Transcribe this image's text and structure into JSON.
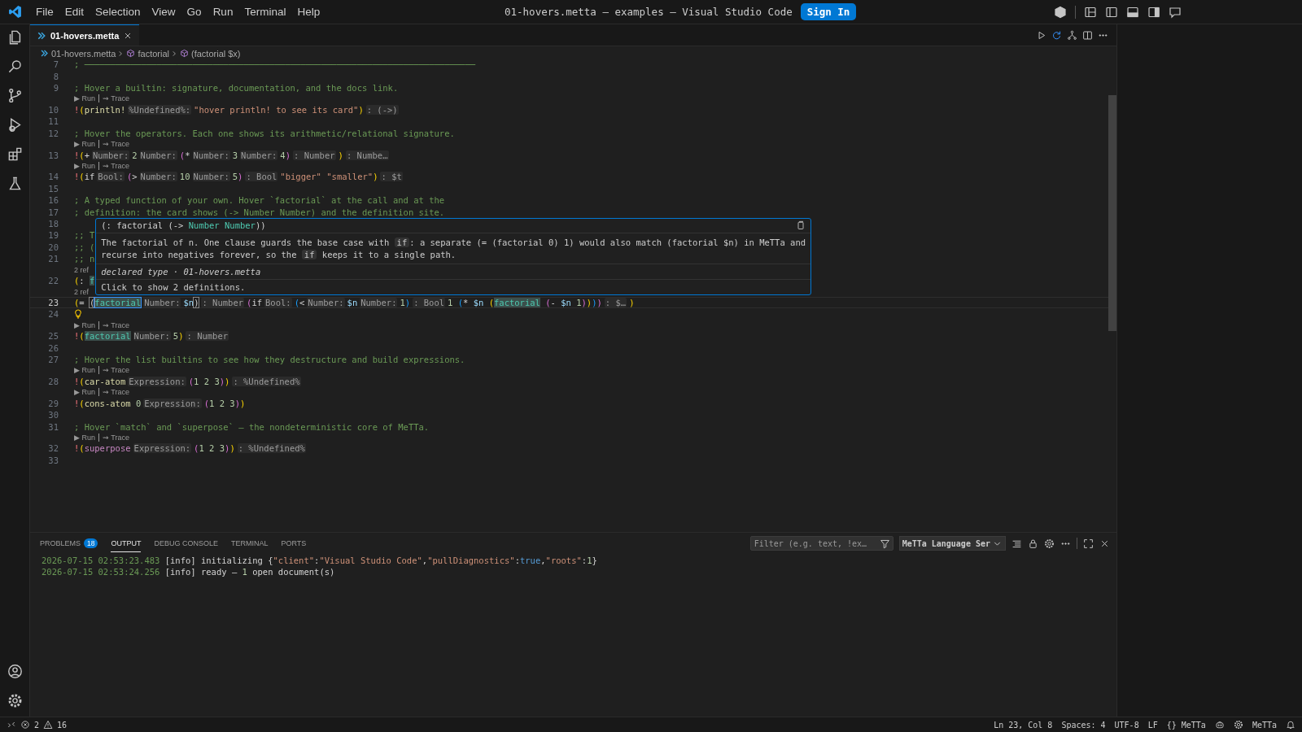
{
  "window": {
    "title": "01-hovers.metta — examples — Visual Studio Code",
    "sign_in": "Sign In"
  },
  "menu": [
    "File",
    "Edit",
    "Selection",
    "View",
    "Go",
    "Run",
    "Terminal",
    "Help"
  ],
  "editor_tabs": [
    {
      "label": "01-hovers.metta",
      "selected": true
    }
  ],
  "breadcrumbs": [
    {
      "kind": "file",
      "label": "01-hovers.metta"
    },
    {
      "kind": "symbol",
      "label": "factorial"
    },
    {
      "kind": "symbol",
      "label": "(factorial $x)"
    }
  ],
  "lines": [
    {
      "kind": "code",
      "number": "7",
      "current": false,
      "tokens": [
        {
          "kind": "comment",
          "text": "; ────────────────────────────────────────────────────────────────────────────"
        }
      ]
    },
    {
      "kind": "code",
      "number": "8",
      "current": false
    },
    {
      "kind": "code",
      "number": "9",
      "current": false,
      "tokens": [
        {
          "kind": "comment",
          "text": "; Hover a builtin: signature, documentation, and the docs link."
        }
      ]
    },
    {
      "kind": "lens",
      "actions": [
        "▶ Run",
        "⇝ Trace"
      ]
    },
    {
      "kind": "code",
      "number": "10",
      "current": false,
      "tokens": [
        {
          "kind": "bang",
          "text": "!"
        },
        {
          "kind": "p1",
          "text": "("
        },
        {
          "kind": "fn",
          "text": "println!"
        },
        {
          "kind": "hint",
          "text": "%Undefined%:"
        },
        {
          "kind": "str",
          "text": "\"hover println! to see its card\""
        },
        {
          "kind": "p1",
          "text": ")"
        },
        {
          "kind": "hint",
          "text": ": (->)"
        }
      ]
    },
    {
      "kind": "code",
      "number": "11",
      "current": false
    },
    {
      "kind": "code",
      "number": "12",
      "current": false,
      "tokens": [
        {
          "kind": "comment",
          "text": "; Hover the operators. Each one shows its arithmetic/relational signature."
        }
      ]
    },
    {
      "kind": "lens",
      "actions": [
        "▶ Run",
        "⇝ Trace"
      ]
    },
    {
      "kind": "code",
      "number": "13",
      "current": false,
      "tokens": [
        {
          "kind": "bang",
          "text": "!"
        },
        {
          "kind": "p1",
          "text": "("
        },
        {
          "kind": "plain",
          "text": "+"
        },
        {
          "kind": "hint",
          "text": "Number:"
        },
        {
          "kind": "num",
          "text": "2"
        },
        {
          "kind": "hint",
          "text": "Number:"
        },
        {
          "kind": "p2",
          "text": "("
        },
        {
          "kind": "plain",
          "text": "*"
        },
        {
          "kind": "hint",
          "text": "Number:"
        },
        {
          "kind": "num",
          "text": "3"
        },
        {
          "kind": "hint",
          "text": "Number:"
        },
        {
          "kind": "num",
          "text": "4"
        },
        {
          "kind": "p2",
          "text": ")"
        },
        {
          "kind": "hint",
          "text": ": Number"
        },
        {
          "kind": "p1",
          "text": ")"
        },
        {
          "kind": "hint",
          "text": ": Numbe…"
        }
      ]
    },
    {
      "kind": "lens",
      "actions": [
        "▶ Run",
        "⇝ Trace"
      ]
    },
    {
      "kind": "code",
      "number": "14",
      "current": false,
      "tokens": [
        {
          "kind": "bang",
          "text": "!"
        },
        {
          "kind": "p1",
          "text": "("
        },
        {
          "kind": "plain",
          "text": "if"
        },
        {
          "kind": "hint",
          "text": "Bool:"
        },
        {
          "kind": "p2",
          "text": "("
        },
        {
          "kind": "plain",
          "text": ">"
        },
        {
          "kind": "hint",
          "text": "Number:"
        },
        {
          "kind": "num",
          "text": "10"
        },
        {
          "kind": "hint",
          "text": "Number:"
        },
        {
          "kind": "num",
          "text": "5"
        },
        {
          "kind": "p2",
          "text": ")"
        },
        {
          "kind": "hint",
          "text": ": Bool"
        },
        {
          "kind": "str",
          "text": "\"bigger\" \"smaller\""
        },
        {
          "kind": "p1",
          "text": ")"
        },
        {
          "kind": "hint",
          "text": ": $t"
        }
      ]
    },
    {
      "kind": "code",
      "number": "15",
      "current": false
    },
    {
      "kind": "code",
      "number": "16",
      "current": false,
      "tokens": [
        {
          "kind": "comment",
          "text": "; A typed function of your own. Hover `factorial` at the call and at the"
        }
      ]
    },
    {
      "kind": "code",
      "number": "17",
      "current": false,
      "tokens": [
        {
          "kind": "comment",
          "text": "; definition: the card shows (-> Number Number) and the definition site."
        }
      ]
    },
    {
      "kind": "code",
      "number": "18",
      "current": false
    },
    {
      "kind": "code",
      "number": "19",
      "current": false,
      "tokens": [
        {
          "kind": "comment",
          "text": ";; T"
        }
      ]
    },
    {
      "kind": "code",
      "number": "20",
      "current": false,
      "tokens": [
        {
          "kind": "comment",
          "text": ";; ("
        }
      ]
    },
    {
      "kind": "code",
      "number": "21",
      "current": false,
      "tokens": [
        {
          "kind": "comment",
          "text": ";; n"
        }
      ]
    },
    {
      "kind": "lens",
      "actions": [
        "2 ref"
      ]
    },
    {
      "kind": "code",
      "number": "22",
      "current": false,
      "tokens": [
        {
          "kind": "p1",
          "text": "("
        },
        {
          "kind": "plain",
          "text": ": "
        },
        {
          "kind": "hl",
          "text": "f"
        }
      ]
    },
    {
      "kind": "lens",
      "actions": [
        "2 ref"
      ]
    },
    {
      "kind": "code",
      "number": "23",
      "current": true,
      "tokens": [
        {
          "kind": "p1",
          "text": "("
        },
        {
          "kind": "plain",
          "text": "= "
        },
        {
          "kind": "match",
          "text": "("
        },
        {
          "kind": "hlsel",
          "text": "factorial"
        },
        {
          "kind": "hint",
          "text": "Number:"
        },
        {
          "kind": "var",
          "text": "$n"
        },
        {
          "kind": "match",
          "text": ")"
        },
        {
          "kind": "hint",
          "text": ": Number"
        },
        {
          "kind": "p2",
          "text": "("
        },
        {
          "kind": "plain",
          "text": "if"
        },
        {
          "kind": "hint",
          "text": "Bool:"
        },
        {
          "kind": "p3",
          "text": "("
        },
        {
          "kind": "plain",
          "text": "<"
        },
        {
          "kind": "hint",
          "text": "Number:"
        },
        {
          "kind": "var",
          "text": "$n"
        },
        {
          "kind": "hint",
          "text": "Number:"
        },
        {
          "kind": "num",
          "text": "1"
        },
        {
          "kind": "p3",
          "text": ")"
        },
        {
          "kind": "hint",
          "text": ": Bool"
        },
        {
          "kind": "num",
          "text": "1 "
        },
        {
          "kind": "p3",
          "text": "("
        },
        {
          "kind": "plain",
          "text": "* "
        },
        {
          "kind": "var",
          "text": "$n "
        },
        {
          "kind": "p1",
          "text": "("
        },
        {
          "kind": "hl",
          "text": "factorial"
        },
        {
          "kind": "p2",
          "text": " ("
        },
        {
          "kind": "plain",
          "text": "- "
        },
        {
          "kind": "var",
          "text": "$n "
        },
        {
          "kind": "num",
          "text": "1"
        },
        {
          "kind": "p2",
          "text": ")"
        },
        {
          "kind": "p1",
          "text": ")"
        },
        {
          "kind": "p3",
          "text": ")"
        },
        {
          "kind": "p2",
          "text": ")"
        },
        {
          "kind": "hint",
          "text": ": $…"
        },
        {
          "kind": "p1",
          "text": ")"
        }
      ]
    },
    {
      "kind": "bulb",
      "number": "24",
      "current": false
    },
    {
      "kind": "lens",
      "actions": [
        "▶ Run",
        "⇝ Trace"
      ]
    },
    {
      "kind": "code",
      "number": "25",
      "current": false,
      "tokens": [
        {
          "kind": "bang",
          "text": "!"
        },
        {
          "kind": "p1",
          "text": "("
        },
        {
          "kind": "hl",
          "text": "factorial"
        },
        {
          "kind": "hint",
          "text": "Number:"
        },
        {
          "kind": "num",
          "text": "5"
        },
        {
          "kind": "p1",
          "text": ")"
        },
        {
          "kind": "hint",
          "text": ": Number"
        }
      ]
    },
    {
      "kind": "code",
      "number": "26",
      "current": false
    },
    {
      "kind": "code",
      "number": "27",
      "current": false,
      "tokens": [
        {
          "kind": "comment",
          "text": "; Hover the list builtins to see how they destructure and build expressions."
        }
      ]
    },
    {
      "kind": "lens",
      "actions": [
        "▶ Run",
        "⇝ Trace"
      ]
    },
    {
      "kind": "code",
      "number": "28",
      "current": false,
      "tokens": [
        {
          "kind": "bang",
          "text": "!"
        },
        {
          "kind": "p1",
          "text": "("
        },
        {
          "kind": "fn",
          "text": "car-atom"
        },
        {
          "kind": "hint",
          "text": "Expression:"
        },
        {
          "kind": "p2",
          "text": "("
        },
        {
          "kind": "num",
          "text": "1 2 3"
        },
        {
          "kind": "p2",
          "text": ")"
        },
        {
          "kind": "p1",
          "text": ")"
        },
        {
          "kind": "hint",
          "text": ": %Undefined%"
        }
      ]
    },
    {
      "kind": "lens",
      "actions": [
        "▶ Run",
        "⇝ Trace"
      ]
    },
    {
      "kind": "code",
      "number": "29",
      "current": false,
      "tokens": [
        {
          "kind": "bang",
          "text": "!"
        },
        {
          "kind": "p1",
          "text": "("
        },
        {
          "kind": "fn",
          "text": "cons-atom "
        },
        {
          "kind": "num",
          "text": "0"
        },
        {
          "kind": "hint",
          "text": "Expression:"
        },
        {
          "kind": "p2",
          "text": "("
        },
        {
          "kind": "num",
          "text": "1 2 3"
        },
        {
          "kind": "p2",
          "text": ")"
        },
        {
          "kind": "p1",
          "text": ")"
        }
      ]
    },
    {
      "kind": "code",
      "number": "30",
      "current": false
    },
    {
      "kind": "code",
      "number": "31",
      "current": false,
      "tokens": [
        {
          "kind": "comment",
          "text": "; Hover `match` and `superpose` — the nondeterministic core of MeTTa."
        }
      ]
    },
    {
      "kind": "lens",
      "actions": [
        "▶ Run",
        "⇝ Trace"
      ]
    },
    {
      "kind": "code",
      "number": "32",
      "current": false,
      "tokens": [
        {
          "kind": "bang",
          "text": "!"
        },
        {
          "kind": "p1",
          "text": "("
        },
        {
          "kind": "kw",
          "text": "superpose"
        },
        {
          "kind": "hint",
          "text": "Expression:"
        },
        {
          "kind": "p2",
          "text": "("
        },
        {
          "kind": "num",
          "text": "1 2 3"
        },
        {
          "kind": "p2",
          "text": ")"
        },
        {
          "kind": "p1",
          "text": ")"
        },
        {
          "kind": "hint",
          "text": ": %Undefined%"
        }
      ]
    },
    {
      "kind": "code",
      "number": "33",
      "current": false
    }
  ],
  "hover": {
    "signature": [
      {
        "kind": "plain",
        "text": "(: factorial (-> "
      },
      {
        "kind": "type",
        "text": "Number Number"
      },
      {
        "kind": "plain",
        "text": "))"
      }
    ],
    "body": [
      {
        "kind": "text",
        "text": "The factorial of n. One clause guards the base case with "
      },
      {
        "kind": "code",
        "text": "if"
      },
      {
        "kind": "text",
        "text": ": a separate (= (factorial 0) 1) would also match (factorial $n) in MeTTa and recurse into negatives forever, so the "
      },
      {
        "kind": "code",
        "text": "if"
      },
      {
        "kind": "text",
        "text": " keeps it to a single path."
      }
    ],
    "source": "declared type · 01-hovers.metta",
    "action": "Click to show 2 definitions."
  },
  "panel": {
    "tabs": [
      {
        "label": "PROBLEMS",
        "badge": "18",
        "selected": false
      },
      {
        "label": "OUTPUT",
        "selected": true
      },
      {
        "label": "DEBUG CONSOLE",
        "selected": false
      },
      {
        "label": "TERMINAL",
        "selected": false
      },
      {
        "label": "PORTS",
        "selected": false
      }
    ],
    "filter": {
      "placeholder": "Filter (e.g. text, !ex…"
    },
    "channel": "MeTTa Language Ser",
    "log": [
      [
        {
          "kind": "time",
          "text": "2026-07-15 02:53:23.483"
        },
        {
          "kind": "plain",
          "text": " [info] initializing {"
        },
        {
          "kind": "str",
          "text": "\"client\""
        },
        {
          "kind": "plain",
          "text": ":"
        },
        {
          "kind": "str",
          "text": "\"Visual Studio Code\""
        },
        {
          "kind": "plain",
          "text": ","
        },
        {
          "kind": "str",
          "text": "\"pullDiagnostics\""
        },
        {
          "kind": "plain",
          "text": ":"
        },
        {
          "kind": "bool",
          "text": "true"
        },
        {
          "kind": "plain",
          "text": ","
        },
        {
          "kind": "str",
          "text": "\"roots\""
        },
        {
          "kind": "plain",
          "text": ":"
        },
        {
          "kind": "num",
          "text": "1"
        },
        {
          "kind": "plain",
          "text": "}"
        }
      ],
      [
        {
          "kind": "time",
          "text": "2026-07-15 02:53:24.256"
        },
        {
          "kind": "plain",
          "text": " [info] ready — "
        },
        {
          "kind": "num",
          "text": "1"
        },
        {
          "kind": "plain",
          "text": " open document(s)"
        }
      ]
    ]
  },
  "status_bar": {
    "errors": "2",
    "warnings": "16",
    "right": [
      {
        "kind": "text",
        "text": "Ln 23, Col 8"
      },
      {
        "kind": "text",
        "text": "Spaces: 4"
      },
      {
        "kind": "text",
        "text": "UTF-8"
      },
      {
        "kind": "text",
        "text": "LF"
      },
      {
        "kind": "text",
        "text": "{} MeTTa"
      },
      {
        "kind": "copilot"
      },
      {
        "kind": "gear",
        "text": "MeTTa"
      },
      {
        "kind": "bell"
      }
    ]
  }
}
